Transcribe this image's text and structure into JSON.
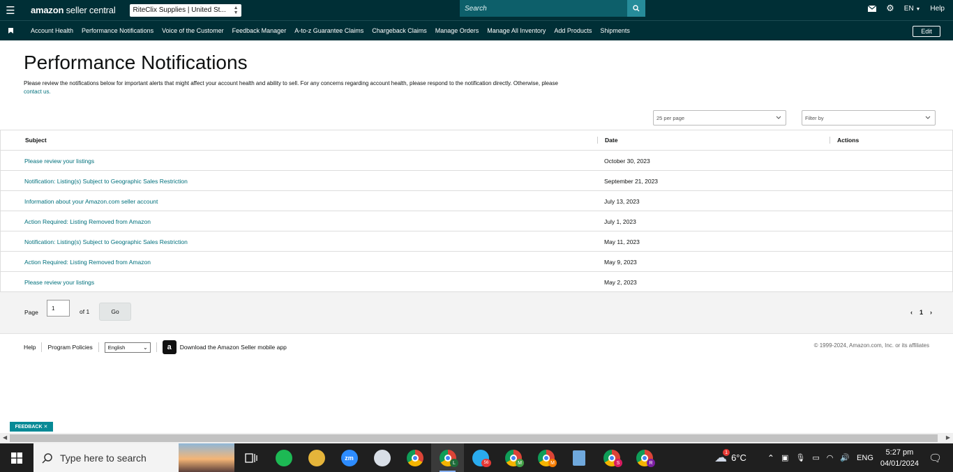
{
  "topbar": {
    "logo_prefix": "amazon",
    "logo_suffix": " seller central",
    "account": "RiteClix Supplies | United St...",
    "search_placeholder": "Search",
    "language": "EN",
    "help": "Help"
  },
  "nav": {
    "items": [
      "Account Health",
      "Performance Notifications",
      "Voice of the Customer",
      "Feedback Manager",
      "A-to-z Guarantee Claims",
      "Chargeback Claims",
      "Manage Orders",
      "Manage All Inventory",
      "Add Products",
      "Shipments"
    ],
    "edit": "Edit"
  },
  "page": {
    "title": "Performance Notifications",
    "intro": "Please review the notifications below for important alerts that might affect your account health and ability to sell. For any concerns regarding account health, please respond to the notification directly. Otherwise, please",
    "contact_link": "contact us.",
    "per_page": "25 per page",
    "filter": "Filter by"
  },
  "table": {
    "headers": {
      "subject": "Subject",
      "date": "Date",
      "actions": "Actions"
    },
    "rows": [
      {
        "subject": "Please review your listings",
        "date": "October 30, 2023"
      },
      {
        "subject": "Notification: Listing(s) Subject to Geographic Sales Restriction",
        "date": "September 21, 2023"
      },
      {
        "subject": "Information about your Amazon.com seller account",
        "date": "July 13, 2023"
      },
      {
        "subject": "Action Required: Listing Removed from Amazon",
        "date": "July 1, 2023"
      },
      {
        "subject": "Notification: Listing(s) Subject to Geographic Sales Restriction",
        "date": "May 11, 2023"
      },
      {
        "subject": "Action Required: Listing Removed from Amazon",
        "date": "May 9, 2023"
      },
      {
        "subject": "Please review your listings",
        "date": "May 2, 2023"
      }
    ]
  },
  "pager": {
    "page_label": "Page",
    "page_value": "1",
    "of_label": "of 1",
    "go": "Go",
    "current": "1",
    "prev": "‹",
    "next": "›"
  },
  "footer": {
    "help": "Help",
    "policies": "Program Policies",
    "language": "English",
    "app_text": "Download the Amazon Seller mobile app",
    "copyright": "© 1999-2024, Amazon.com, Inc. or its affiliates"
  },
  "feedback": "FEEDBACK ✕",
  "taskbar": {
    "search_placeholder": "Type here to search",
    "telegram_badge": "56",
    "weather_badge": "1",
    "temperature": "6°C",
    "lang": "ENG",
    "time": "5:27 pm",
    "date": "04/01/2024",
    "chrome_profiles": [
      "L",
      "M",
      "M",
      "S",
      "R"
    ]
  },
  "colors": {
    "header_bg": "#002f36",
    "link": "#00707c",
    "feedback_bg": "#078a96"
  }
}
